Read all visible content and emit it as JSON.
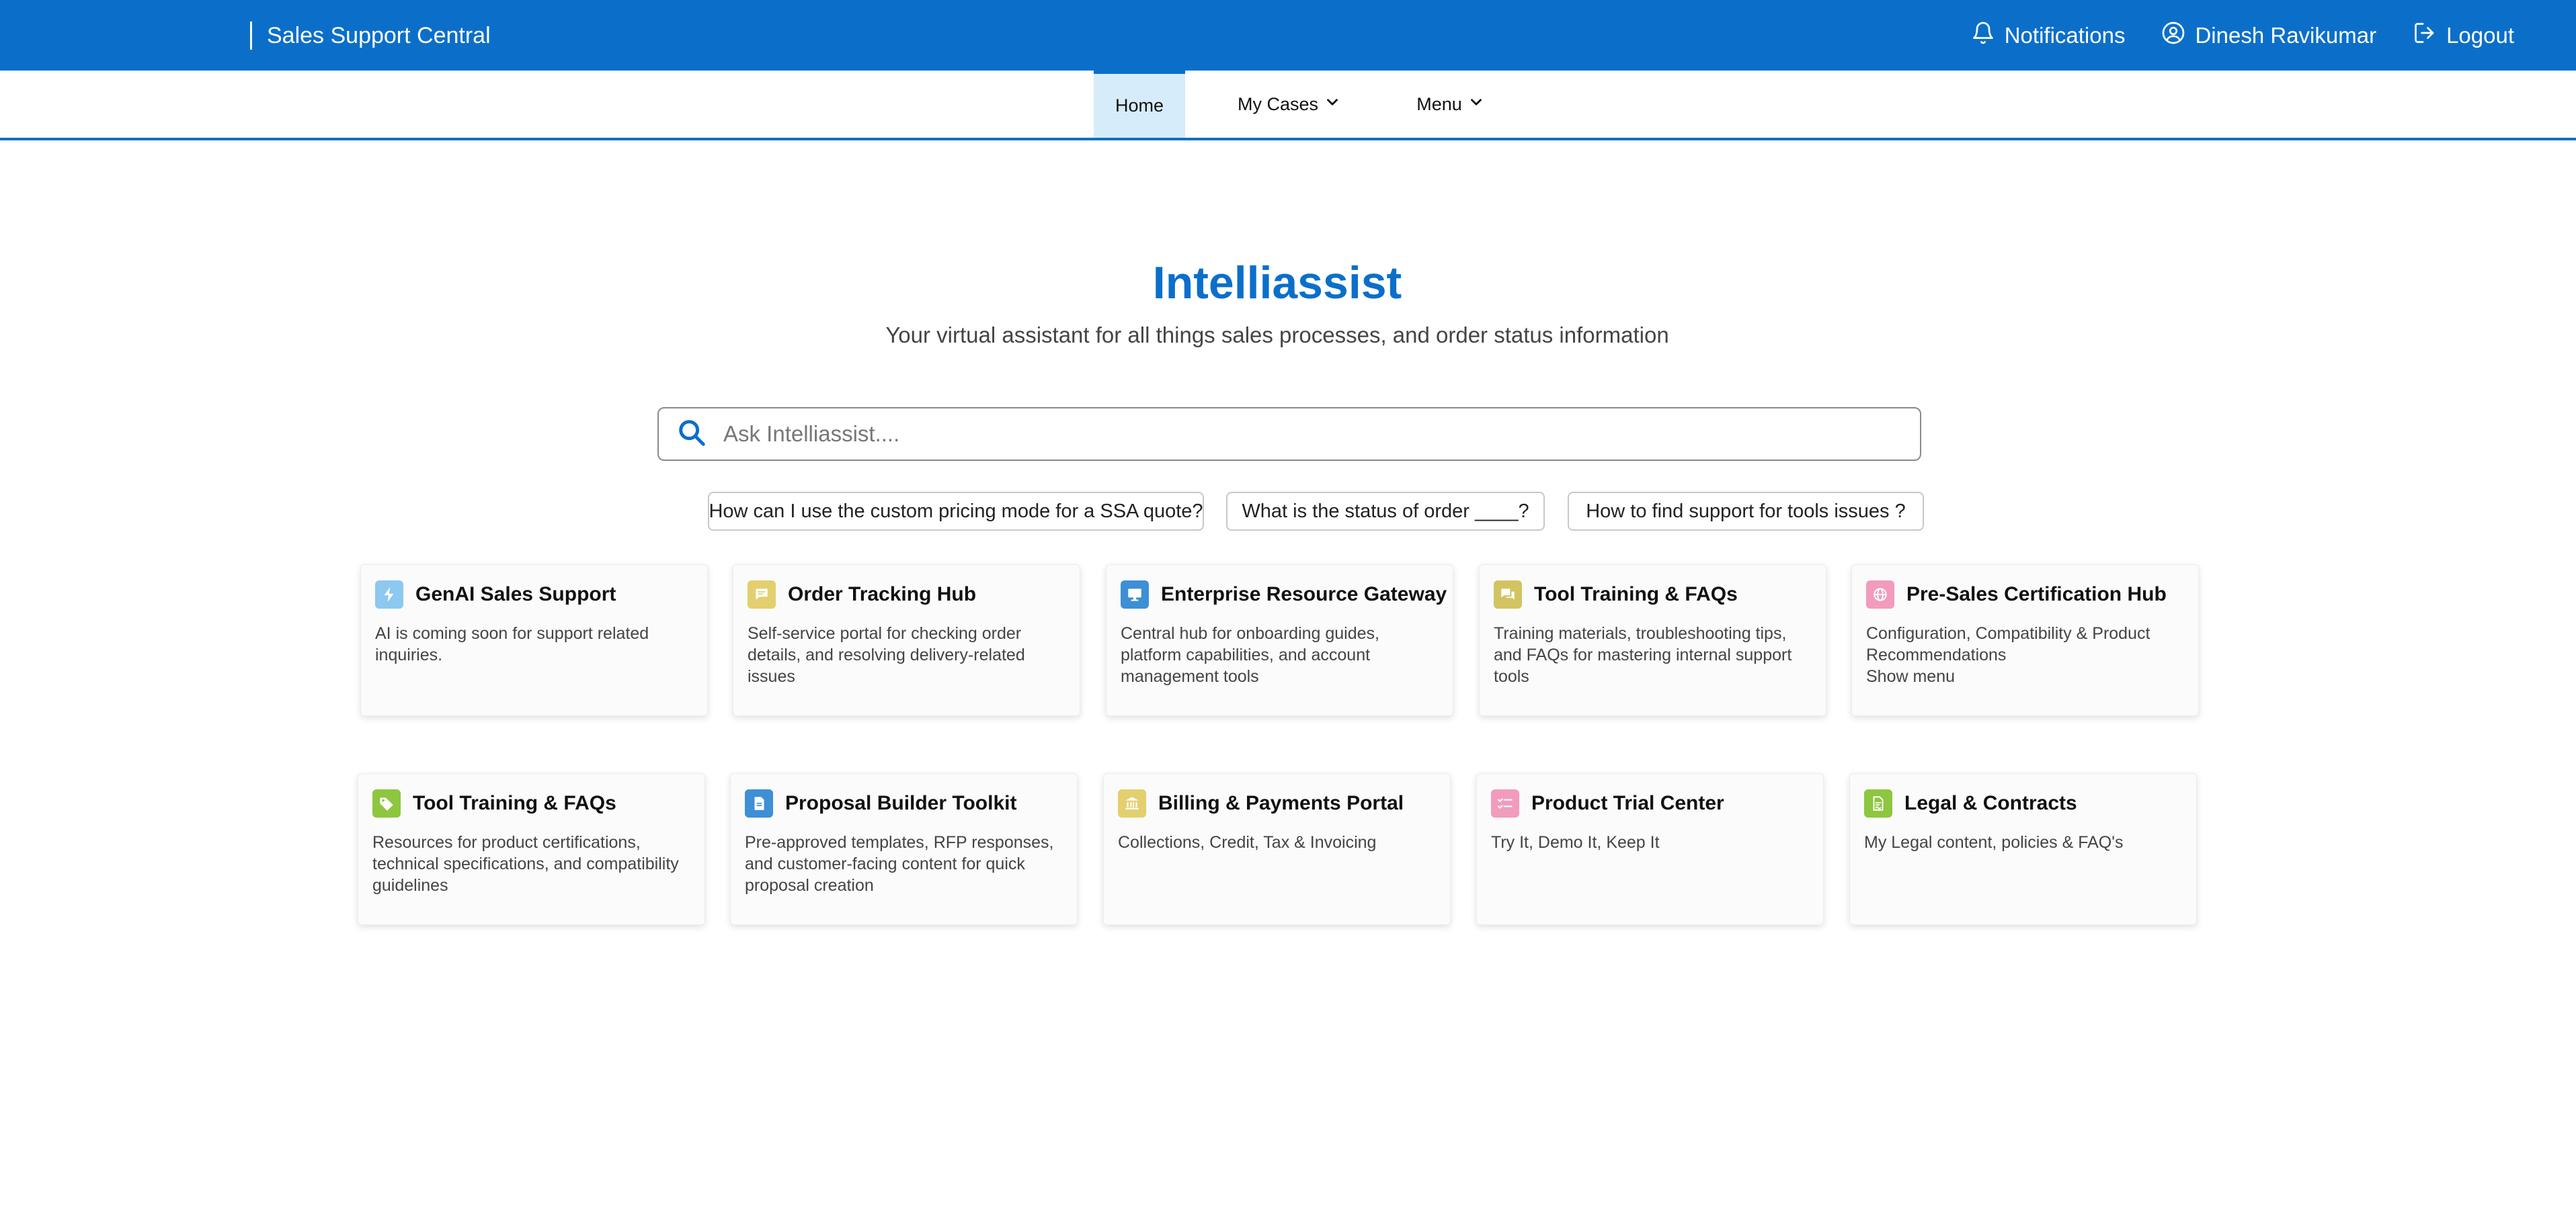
{
  "header": {
    "app_title": "Sales Support Central",
    "notifications_label": "Notifications",
    "user_name": "Dinesh Ravikumar",
    "logout_label": "Logout",
    "color": "#0b6fca"
  },
  "nav": {
    "home_label": "Home",
    "my_cases_label": "My Cases",
    "menu_label": "Menu",
    "active": "Home"
  },
  "hero": {
    "title": "Intelliassist",
    "subtitle": "Your virtual assistant for all things sales processes, and order status information"
  },
  "search": {
    "placeholder": "Ask Intelliassist....",
    "value": ""
  },
  "suggestions": [
    "How can I use the custom pricing mode for a SSA quote?",
    "What is the status of order ____?",
    "How to find support for tools issues ?"
  ],
  "cards": [
    {
      "title": "GenAI Sales Support",
      "description": "AI is coming soon for support related inquiries.",
      "icon": "bolt-icon",
      "icon_color": "#8cc8ef"
    },
    {
      "title": "Order Tracking Hub",
      "description": "Self-service portal for checking order details, and resolving delivery-related issues",
      "icon": "chat-icon",
      "icon_color": "#e3cf6e"
    },
    {
      "title": "Enterprise Resource Gateway",
      "description": "Central hub for onboarding guides, platform capabilities, and account management tools",
      "icon": "monitor-icon",
      "icon_color": "#3d8fd6"
    },
    {
      "title": "Tool Training & FAQs",
      "description": "Training materials, troubleshooting tips, and FAQs for mastering internal support tools",
      "icon": "chat-bubbles-icon",
      "icon_color": "#d2c461"
    },
    {
      "title": "Pre-Sales Certification Hub",
      "description": "Configuration, Compatibility & Product Recommendations",
      "extra": "Show menu",
      "icon": "globe-icon",
      "icon_color": "#f29bbd"
    },
    {
      "title": "Tool Training & FAQs",
      "description": "Resources for product certifications, technical specifications, and compatibility guidelines",
      "icon": "tag-icon",
      "icon_color": "#8dc63f"
    },
    {
      "title": "Proposal Builder Toolkit",
      "description": "Pre-approved templates, RFP responses, and customer-facing content for quick proposal creation",
      "icon": "document-icon",
      "icon_color": "#3d8fd6"
    },
    {
      "title": "Billing & Payments Portal",
      "description": "Collections, Credit, Tax & Invoicing",
      "icon": "bank-icon",
      "icon_color": "#e3cf6e"
    },
    {
      "title": "Product Trial Center",
      "description": "Try It, Demo It, Keep It",
      "icon": "checklist-icon",
      "icon_color": "#f29bbd"
    },
    {
      "title": "Legal & Contracts",
      "description": "My Legal content, policies & FAQ's",
      "icon": "contract-icon",
      "icon_color": "#8dc63f"
    }
  ]
}
